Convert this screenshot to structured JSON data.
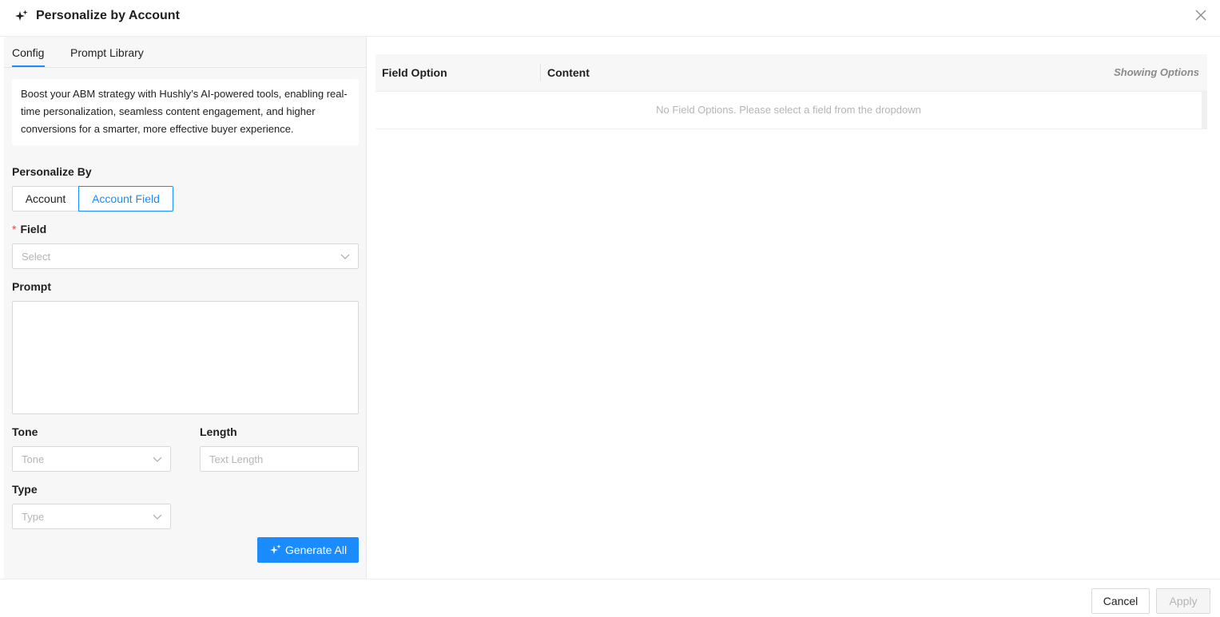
{
  "modal": {
    "title": "Personalize by Account",
    "title_icon": "sparkle-icon",
    "close_icon": "close-icon"
  },
  "tabs": [
    {
      "label": "Config",
      "active": true
    },
    {
      "label": "Prompt Library",
      "active": false
    }
  ],
  "intro_text": "Boost your ABM strategy with Hushly’s AI-powered tools, enabling real-time personalization, seamless content engagement, and higher conversions for a smarter, more effective buyer experience.",
  "form": {
    "personalize_by_label": "Personalize By",
    "segments": [
      {
        "label": "Account",
        "active": false
      },
      {
        "label": "Account Field",
        "active": true
      }
    ],
    "field": {
      "label": "Field",
      "required": true,
      "placeholder": "Select"
    },
    "prompt": {
      "label": "Prompt",
      "value": ""
    },
    "tone": {
      "label": "Tone",
      "placeholder": "Tone"
    },
    "length": {
      "label": "Length",
      "placeholder": "Text Length"
    },
    "type": {
      "label": "Type",
      "placeholder": "Type"
    },
    "generate_button": {
      "label": "Generate All",
      "icon": "sparkle-icon"
    }
  },
  "table": {
    "columns": [
      "Field Option",
      "Content"
    ],
    "showing_options_label": "Showing Options",
    "empty_text": "No Field Options. Please select a field from the dropdown"
  },
  "footer": {
    "cancel_label": "Cancel",
    "apply_label": "Apply"
  },
  "colors": {
    "primary": "#1a8cff",
    "panel_bg": "#f7f7f8",
    "required": "#e34d59"
  }
}
